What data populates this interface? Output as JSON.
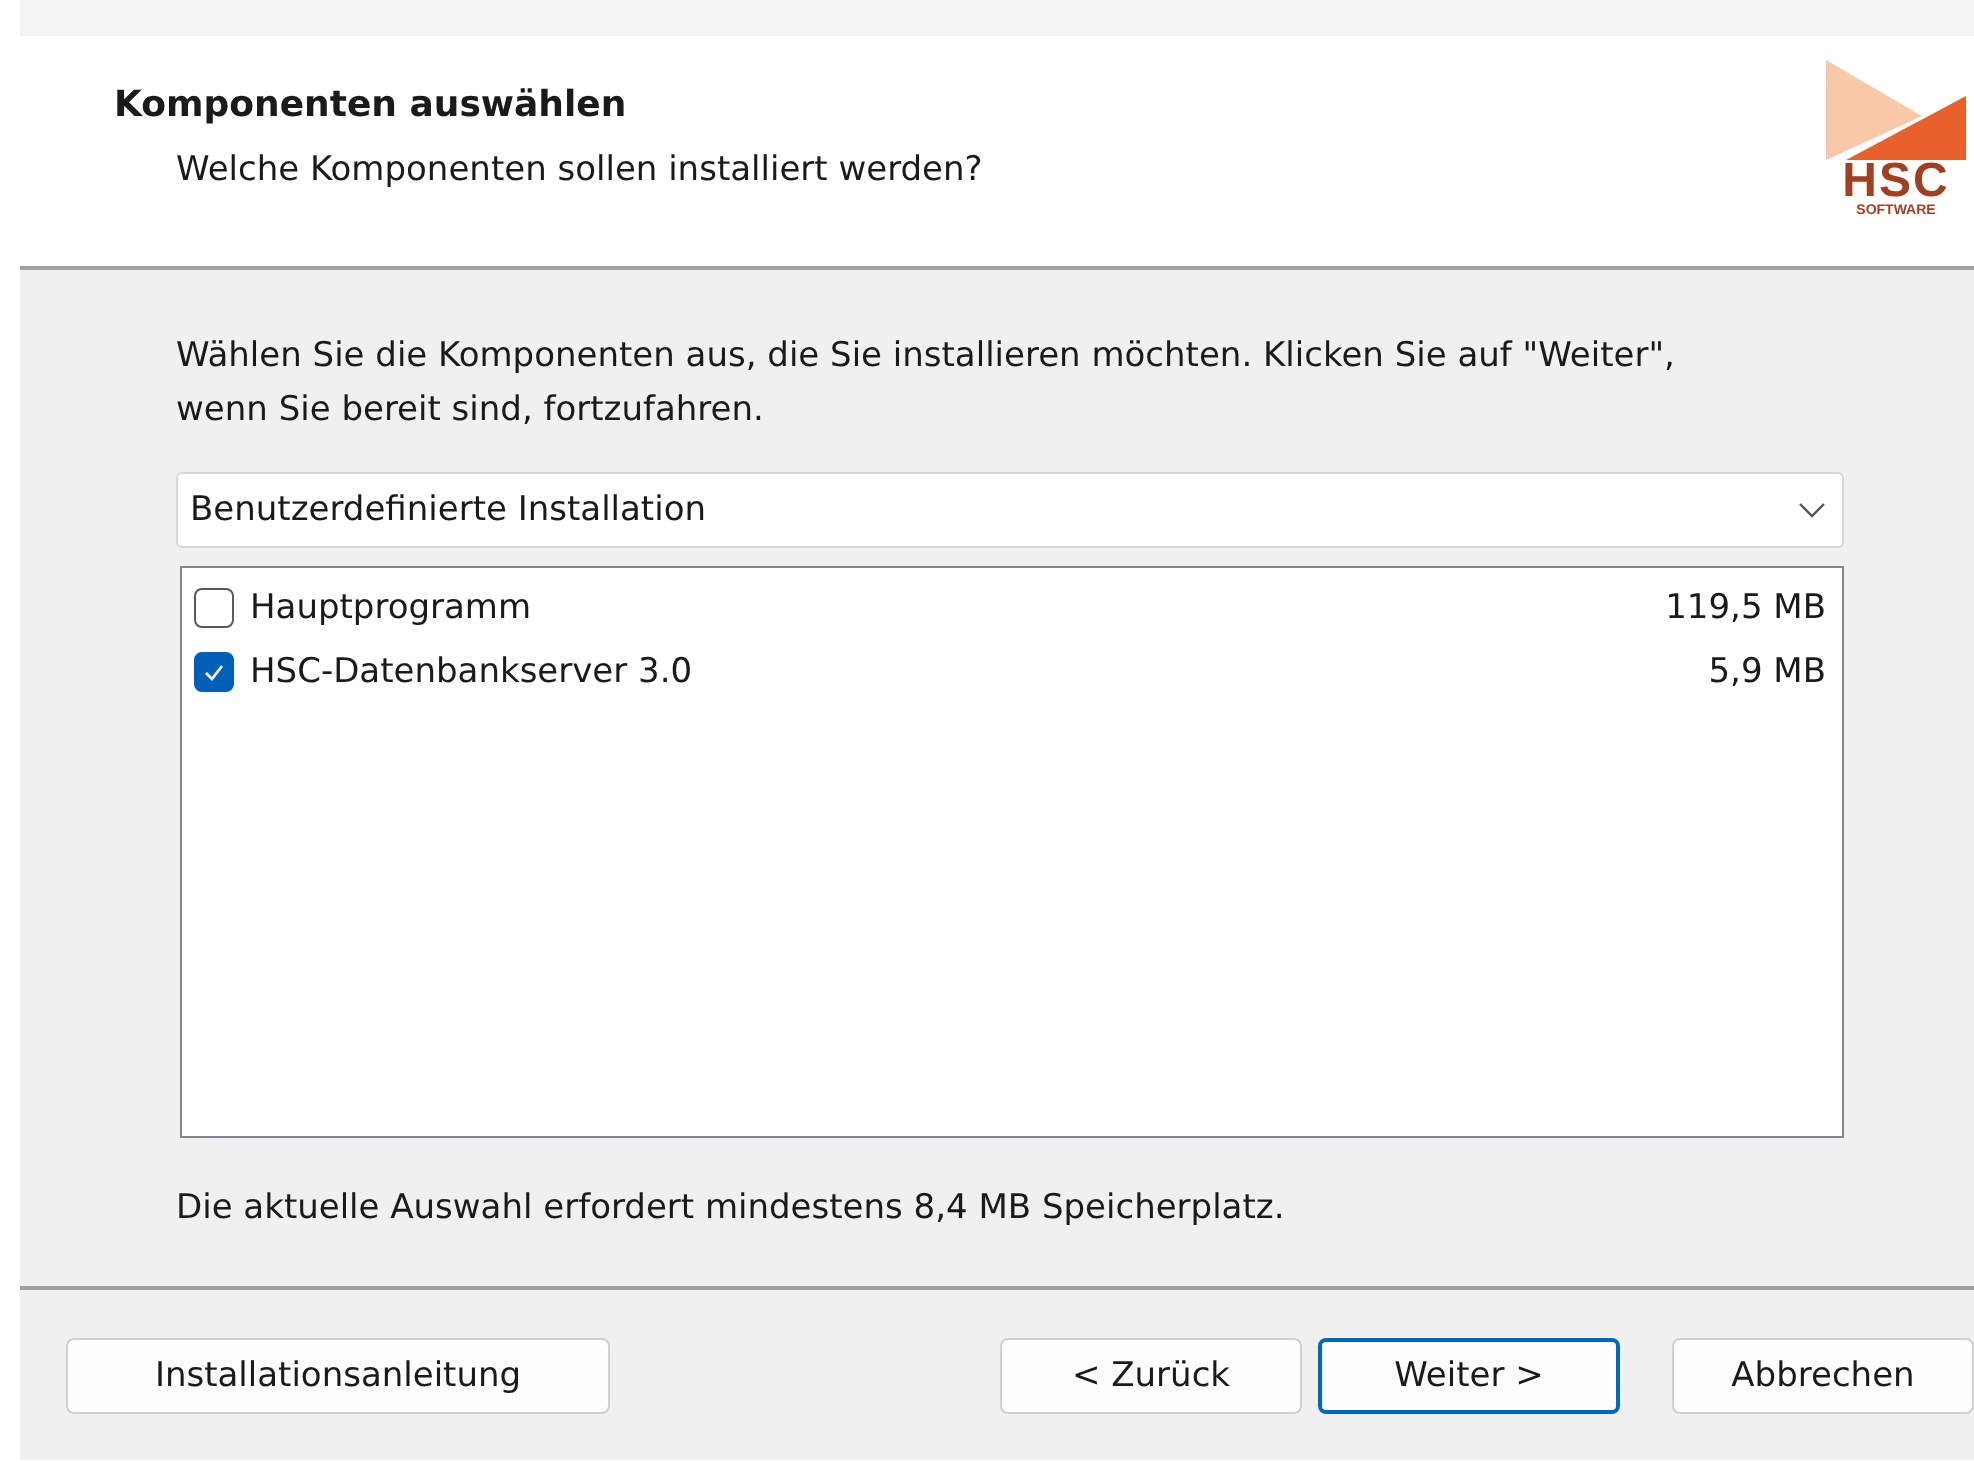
{
  "header": {
    "title": "Komponenten auswählen",
    "subtitle": "Welche Komponenten sollen installiert werden?",
    "logo": {
      "name": "HSC",
      "tagline": "SOFTWARE"
    }
  },
  "instructions": "Wählen Sie die Komponenten aus, die Sie installieren möchten. Klicken Sie auf \"Weiter\", wenn Sie bereit sind, fortzufahren.",
  "setup_type": {
    "value": "Benutzerdefinierte Installation"
  },
  "components": [
    {
      "name": "Hauptprogramm",
      "size": "119,5 MB",
      "checked": false
    },
    {
      "name": "HSC-Datenbankserver 3.0",
      "size": "5,9 MB",
      "checked": true
    }
  ],
  "space_note": "Die aktuelle Auswahl erfordert mindestens 8,4 MB Speicherplatz.",
  "buttons": [
    {
      "label": "Installationsanleitung",
      "kind": "left",
      "default": false
    },
    {
      "label": "< Zurück",
      "kind": "nav",
      "default": false
    },
    {
      "label": "Weiter >",
      "kind": "nav",
      "default": true
    },
    {
      "label": "Abbrechen",
      "kind": "cancel",
      "default": false
    }
  ]
}
